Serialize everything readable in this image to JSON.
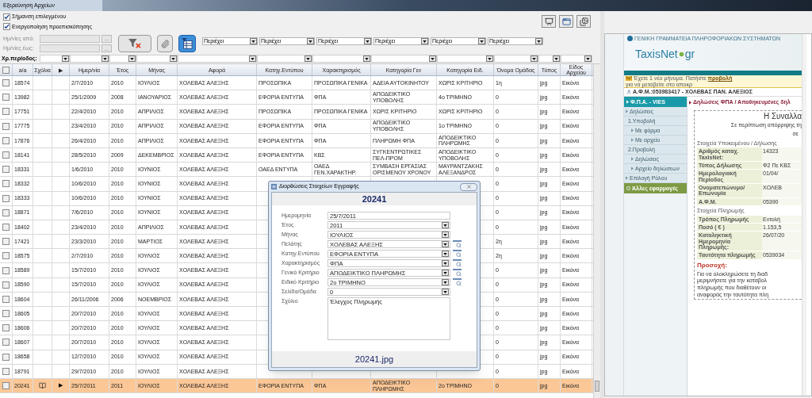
{
  "window": {
    "title": "Εξερεύνηση Αρχείων"
  },
  "options": [
    {
      "label": "Σήμανση επιλεγμένου",
      "checked": true
    },
    {
      "label": "Ενεργοποίηση προεπισκόπησης",
      "checked": true
    }
  ],
  "date_filters": [
    {
      "label": "Ημ/νίες από:",
      "button": "...",
      "disabled": true
    },
    {
      "label": "Ημ/νίες έως:",
      "button": "...",
      "disabled": true
    }
  ],
  "toolbar": [
    {
      "kind": "clear_filter",
      "selected": false
    },
    {
      "kind": "attachment",
      "selected": false
    },
    {
      "kind": "filter_view",
      "selected": true
    }
  ],
  "text_filters": [
    "Περιέχει",
    "Περιέχει",
    "Περιέχει",
    "Περιέχει",
    "Περιέχει",
    "Περιέχει"
  ],
  "period_label": "Χρ.περίοδος:",
  "header_checkbox": {
    "checked": false
  },
  "columns": [
    "a/a",
    "Σχόλια",
    "▶",
    "Ημερ/νία",
    "Έτος",
    "Μήνας",
    "Αφορά",
    "Κατηγ.Εντύπου",
    "Χαρακτηρισμός",
    "Κατηγορία Γεν",
    "Κατηγορία Ειδ.",
    "Όνομα Ομάδας",
    "Τύπος",
    "Είδος Αρχείου"
  ],
  "rows": [
    {
      "selected": false,
      "checked": false,
      "has_comment": false,
      "a_a": "18574",
      "date": "2/7/2010",
      "year": "2010",
      "month": "ΙΟΥΛΙΟΣ",
      "subject": "ΧΟΛΕΒΑΣ ΑΛΕΞΗΣ",
      "form": "ΠΡΟΣΩΠΙΚΑ",
      "characterization": "ΠΡΟΣΩΠΙΚΑ ΓΕΝΙΚΑ",
      "general": "ΑΔΕΙΑ ΑΥΤΟΚΙΝΗΤΟΥ",
      "specific": "ΧΩΡΙΣ ΚΡΙΤΗΡΙΟ",
      "group": "1η",
      "type": "jpg",
      "kind": "Εικόνα"
    },
    {
      "selected": false,
      "checked": false,
      "has_comment": false,
      "a_a": "13982",
      "date": "25/1/2009",
      "year": "2008",
      "month": "ΙΑΝΟΥΑΡΙΟΣ",
      "subject": "ΧΟΛΕΒΑΣ ΑΛΕΞΗΣ",
      "form": "ΕΦΟΡΙΑ ΕΝΤΥΠΑ",
      "characterization": "ΦΠΑ",
      "general": "ΑΠΟΔΕΙΚΤΙΚΟ ΥΠΟΒΟΛΗΣ",
      "specific": "4ο ΤΡΙΜΗΝΟ",
      "group": "0",
      "type": "jpg",
      "kind": "Εικόνα"
    },
    {
      "selected": false,
      "checked": false,
      "has_comment": false,
      "a_a": "17751",
      "date": "22/4/2010",
      "year": "2010",
      "month": "ΑΠΡΙΛΙΟΣ",
      "subject": "ΧΟΛΕΒΑΣ ΑΛΕΞΗΣ",
      "form": "ΠΡΟΣΩΠΙΚΑ",
      "characterization": "ΠΡΟΣΩΠΙΚΑ ΓΕΝΙΚΑ",
      "general": "ΧΩΡΙΣ ΚΡΙΤΗΡΙΟ",
      "specific": "ΧΩΡΙΣ ΚΡΙΤΗΡΙΟ",
      "group": "0",
      "type": "jpg",
      "kind": "Εικόνα"
    },
    {
      "selected": false,
      "checked": false,
      "has_comment": false,
      "a_a": "17775",
      "date": "23/4/2010",
      "year": "2010",
      "month": "ΑΠΡΙΛΙΟΣ",
      "subject": "ΧΟΛΕΒΑΣ ΑΛΕΞΗΣ",
      "form": "ΕΦΟΡΙΑ ΕΝΤΥΠΑ",
      "characterization": "ΦΠΑ",
      "general": "ΑΠΟΔΕΙΚΤΙΚΟ ΥΠΟΒΟΛΗΣ",
      "specific": "1ο ΤΡΙΜΗΝΟ",
      "group": "0",
      "type": "jpg",
      "kind": "Εικόνα"
    },
    {
      "selected": false,
      "checked": false,
      "has_comment": false,
      "a_a": "17876",
      "date": "26/4/2010",
      "year": "2010",
      "month": "ΑΠΡΙΛΙΟΣ",
      "subject": "ΧΟΛΕΒΑΣ ΑΛΕΞΗΣ",
      "form": "ΕΦΟΡΙΑ ΕΝΤΥΠΑ",
      "characterization": "ΦΠΑ",
      "general": "ΠΛΗΡΩΜΗ ΦΠΑ",
      "specific": "ΑΠΟΔΕΙΚΤΙΚΟ ΠΛΗΡΩΜΗΣ",
      "group": "0",
      "type": "jpg",
      "kind": "Εικόνα"
    },
    {
      "selected": false,
      "checked": false,
      "has_comment": false,
      "a_a": "18141",
      "date": "28/5/2010",
      "year": "2009",
      "month": "ΔΕΚΕΜΒΡΙΟΣ",
      "subject": "ΧΟΛΕΒΑΣ ΑΛΕΞΗΣ",
      "form": "ΕΦΟΡΙΑ ΕΝΤΥΠΑ",
      "characterization": "ΚΒΣ",
      "general": "ΣΥΓΚΕΝΤΡΩΤΙΚΕΣ ΠΕΛ-ΠΡΟΜ",
      "specific": "ΑΠΟΔΕΙΚΤΙΚΟ ΥΠΟΒΟΛΗΣ",
      "group": "0",
      "type": "jpg",
      "kind": "Εικόνα"
    },
    {
      "selected": false,
      "checked": false,
      "has_comment": false,
      "a_a": "18331",
      "date": "1/6/2010",
      "year": "2010",
      "month": "ΙΟΥΝΙΟΣ",
      "subject": "ΧΟΛΕΒΑΣ ΑΛΕΞΗΣ",
      "form": "ΟΑΕΔ ΕΝΤΥΠΑ",
      "characterization": "ΟΑΕΔ ΓΕΝ.ΧΑΡΑΚΤΗΡ.",
      "general": "ΣΥΜΒΑΣΗ ΕΡΓΑΣΙΑΣ ΟΡΙΣΜΕΝΟΥ ΧΡΟΝΟΥ",
      "specific": "ΜΑΥΡΑΝΤΖΑΚΗΣ ΑΛΕΞΑΝΔΡΟΣ",
      "group": "0",
      "type": "jpg",
      "kind": "Εικόνα"
    },
    {
      "selected": false,
      "checked": false,
      "has_comment": false,
      "a_a": "18332",
      "date": "10/6/2010",
      "year": "2010",
      "month": "ΙΟΥΝΙΟΣ",
      "subject": "ΧΟΛΕΒΑΣ ΑΛΕΞΗΣ",
      "group": "0",
      "type": "jpg",
      "kind": "Εικόνα"
    },
    {
      "selected": false,
      "checked": false,
      "has_comment": false,
      "a_a": "18333",
      "date": "10/6/2010",
      "year": "2010",
      "month": "ΙΟΥΝΙΟΣ",
      "subject": "ΧΟΛΕΒΑΣ ΑΛΕΞΗΣ",
      "group": "0",
      "type": "jpg",
      "kind": "Εικόνα"
    },
    {
      "selected": false,
      "checked": false,
      "has_comment": false,
      "a_a": "18871",
      "date": "7/6/2010",
      "year": "2010",
      "month": "ΙΟΥΝΙΟΣ",
      "subject": "ΧΟΛΕΒΑΣ ΑΛΕΞΗΣ",
      "group": "0",
      "type": "jpg",
      "kind": "Εικόνα"
    },
    {
      "selected": false,
      "checked": false,
      "has_comment": false,
      "a_a": "18402",
      "date": "23/4/2010",
      "year": "2010",
      "month": "ΑΠΡΙΛΙΟΣ",
      "subject": "ΧΟΛΕΒΑΣ ΑΛΕΞΗΣ",
      "group": "0",
      "type": "jpg",
      "kind": "Εικόνα"
    },
    {
      "selected": false,
      "checked": false,
      "has_comment": false,
      "a_a": "17421",
      "date": "23/3/2010",
      "year": "2010",
      "month": "ΜΑΡΤΙΟΣ",
      "subject": "ΧΟΛΕΒΑΣ ΑΛΕΞΗΣ",
      "group": "2η",
      "type": "jpg",
      "kind": "Εικόνα"
    },
    {
      "selected": false,
      "checked": false,
      "has_comment": false,
      "a_a": "18575",
      "date": "2/7/2010",
      "year": "2010",
      "month": "ΙΟΥΛΙΟΣ",
      "subject": "ΧΟΛΕΒΑΣ ΑΛΕΞΗΣ",
      "group": "2η",
      "type": "jpg",
      "kind": "Εικόνα"
    },
    {
      "selected": false,
      "checked": false,
      "has_comment": false,
      "a_a": "18589",
      "date": "15/7/2010",
      "year": "2010",
      "month": "ΙΟΥΛΙΟΣ",
      "subject": "ΧΟΛΕΒΑΣ ΑΛΕΞΗΣ",
      "group": "0",
      "type": "jpg",
      "kind": "Εικόνα"
    },
    {
      "selected": false,
      "checked": false,
      "has_comment": false,
      "a_a": "18590",
      "date": "15/7/2010",
      "year": "2010",
      "month": "ΙΟΥΛΙΟΣ",
      "subject": "ΧΟΛΕΒΑΣ ΑΛΕΞΗΣ",
      "group": "0",
      "type": "jpg",
      "kind": "Εικόνα"
    },
    {
      "selected": false,
      "checked": false,
      "has_comment": false,
      "a_a": "18604",
      "date": "26/11/2006",
      "year": "2006",
      "month": "ΝΟΕΜΒΡΙΟΣ",
      "subject": "ΧΟΛΕΒΑΣ ΑΛΕΞΗΣ",
      "group": "0",
      "type": "jpg",
      "kind": "Εικόνα"
    },
    {
      "selected": false,
      "checked": false,
      "has_comment": false,
      "a_a": "18605",
      "date": "20/7/2010",
      "year": "2010",
      "month": "ΙΟΥΛΙΟΣ",
      "subject": "ΧΟΛΕΒΑΣ ΑΛΕΞΗΣ",
      "group": "0",
      "type": "jpg",
      "kind": "Εικόνα"
    },
    {
      "selected": false,
      "checked": false,
      "has_comment": false,
      "a_a": "18606",
      "date": "20/7/2010",
      "year": "2010",
      "month": "ΙΟΥΛΙΟΣ",
      "subject": "ΧΟΛΕΒΑΣ ΑΛΕΞΗΣ",
      "group": "0",
      "type": "jpg",
      "kind": "Εικόνα"
    },
    {
      "selected": false,
      "checked": false,
      "has_comment": false,
      "a_a": "18607",
      "date": "20/7/2010",
      "year": "2010",
      "month": "ΙΟΥΛΙΟΣ",
      "subject": "ΧΟΛΕΒΑΣ ΑΛΕΞΗΣ",
      "group": "0",
      "type": "jpg",
      "kind": "Εικόνα"
    },
    {
      "selected": false,
      "checked": false,
      "has_comment": false,
      "a_a": "18658",
      "date": "12/7/2010",
      "year": "2010",
      "month": "ΙΟΥΛΙΟΣ",
      "subject": "ΧΟΛΕΒΑΣ ΑΛΕΞΗΣ",
      "group": "0",
      "type": "jpg",
      "kind": "Εικόνα"
    },
    {
      "selected": false,
      "checked": false,
      "has_comment": false,
      "a_a": "18791",
      "date": "29/7/2010",
      "year": "2010",
      "month": "ΙΟΥΛΙΟΣ",
      "subject": "ΧΟΛΕΒΑΣ ΑΛΕΞΗΣ",
      "group": "0",
      "type": "jpg",
      "kind": "Εικόνα"
    },
    {
      "selected": true,
      "checked": false,
      "has_comment": true,
      "marker": "▶",
      "a_a": "20241",
      "date": "25/7/2011",
      "year": "2011",
      "month": "ΙΟΥΛΙΟΣ",
      "subject": "ΧΟΛΕΒΑΣ ΑΛΕΞΗΣ",
      "form": "ΕΦΟΡΙΑ ΕΝΤΥΠΑ",
      "characterization": "ΦΠΑ",
      "general": "ΑΠΟΔΕΙΚΤΙΚΟ ΠΛΗΡΩΜΗΣ",
      "specific": "2ο ΤΡΙΜΗΝΟ",
      "group": "0",
      "type": "jpg",
      "kind": "Εικόνα"
    }
  ],
  "dialog": {
    "title": "Διορθώσεις Στοιχείων Εγγραφής",
    "header": "20241",
    "footer": "20241.jpg",
    "fields": [
      {
        "label": "Ημερομηνία",
        "value": "25/7/2011",
        "kind": "text"
      },
      {
        "label": "Έτος",
        "value": "2011",
        "kind": "select"
      },
      {
        "label": "Μήνας",
        "value": "ΙΟΥΛΙΟΣ",
        "kind": "select"
      },
      {
        "label": "Πελάτης",
        "value": "ΧΟΛΕΒΑΣ ΑΛΕΞΗΣ",
        "kind": "lookup"
      },
      {
        "label": "Κατηγ.Εντύπου",
        "value": "ΕΦΟΡΙΑ ΕΝΤΥΠΑ",
        "kind": "lookup"
      },
      {
        "label": "Χαρακτηρισμός",
        "value": "ΦΠΑ",
        "kind": "lookup"
      },
      {
        "label": "Γενικό Κριτήριο",
        "value": "ΑΠΟΔΕΙΚΤΙΚΟ ΠΛΗΡΩΜΗΣ",
        "kind": "lookup"
      },
      {
        "label": "Ειδικό Κριτήριο",
        "value": "2ο ΤΡΙΜΗΝΟ",
        "kind": "lookup"
      },
      {
        "label": "Σελίδα/Ομάδα",
        "value": "0",
        "kind": "select"
      },
      {
        "label": "Σχόλιο",
        "value": "Έλεγχος Πληρωμής",
        "kind": "memo"
      }
    ]
  },
  "preview": {
    "agency": "ΓΕΝΙΚΗ ΓΡΑΜΜΑΤΕΙΑ ΠΛΗΡΟΦΟΡΙΑΚΩΝ ΣΥΣΤΗΜΑΤΩΝ",
    "logo_name": "TaxisNet",
    "logo_domain": "gr",
    "notice_before": "Έχετε 1 νέο μήνυμα. Πατήστε",
    "notice_link": "προβολή",
    "notice_after": "για να μεταβείτε στο αποκρ",
    "user": "Α.Φ.Μ.:053983417 - ΧΟΛΕΒΑΣ ΠΑΝ. ΑΛΕΞΙΟΣ",
    "menu_title": "Φ.Π.Α. - VIES",
    "menu": [
      {
        "label": "Δηλώσεις",
        "children": [
          {
            "label": "1.Υποβολή",
            "children": [
              {
                "label": "Με φόρμα"
              },
              {
                "label": "Με αρχείο"
              }
            ]
          },
          {
            "label": "2.Προβολή",
            "children": [
              {
                "label": "Δηλώσεις"
              },
              {
                "label": "Αρχείο δηλώσεων"
              }
            ]
          }
        ]
      },
      {
        "label": "Επιλογή Ρόλου"
      }
    ],
    "other_apps": "Άλλες εφαρμογές",
    "breadcrumb": "Δηλώσεις ΦΠΑ / Αποθηκευμένες δηλ",
    "heading": "Η Συναλλα",
    "subheading": "Σε περίπτωση απόρριψης τη",
    "subheading_2": "σε",
    "sections": [
      {
        "title": "Στοιχεία Υποκειμένου / Δήλωσης",
        "rows": [
          {
            "label": "Αριθμός καταχ. TaxisNet:",
            "value": "14323"
          },
          {
            "label": "Τύπος Δήλωσης",
            "value": "Φ2 Πε ΚΒΣ"
          },
          {
            "label": "Ημερολογιακή Περίοδος",
            "value": "01/04/"
          },
          {
            "label": "Ονοματεπώνυμο/ Επωνυμία",
            "value": "ΧΟΛΕΒ"
          },
          {
            "label": "Α.Φ.Μ.",
            "value": "05390"
          }
        ]
      },
      {
        "title": "Στοιχεία Πληρωμής",
        "rows": [
          {
            "label": "Τρόπος Πληρωμής",
            "value": "Εντολή"
          },
          {
            "label": "Ποσό ( € )",
            "value": "1.153,5"
          },
          {
            "label": "Καταληκτική Ημερομηνία Πληρωμής:",
            "value": "26/07/20"
          },
          {
            "label": "Ταυτότητα πληρωμής",
            "value": "0539034"
          }
        ]
      }
    ],
    "warning_title": "Προσοχή:",
    "warning_lines": [
      "Για να ολοκληρώσετε τη διαδ",
      "μεριμνήσετε για την καταβολ",
      "πληρωμής που διαθέτουν οι",
      "αναφοράς την ταυτότητα πλη"
    ]
  }
}
